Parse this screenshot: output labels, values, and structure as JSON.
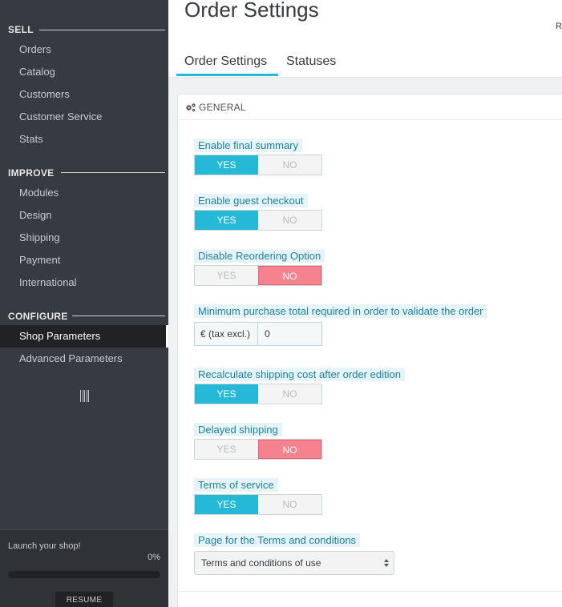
{
  "sidebar": {
    "sections": [
      {
        "title": "SELL",
        "items": [
          "Orders",
          "Catalog",
          "Customers",
          "Customer Service",
          "Stats"
        ]
      },
      {
        "title": "IMPROVE",
        "items": [
          "Modules",
          "Design",
          "Shipping",
          "Payment",
          "International"
        ]
      },
      {
        "title": "CONFIGURE",
        "items": [
          "Shop Parameters",
          "Advanced Parameters"
        ]
      }
    ],
    "active_item": "Shop Parameters",
    "launch": {
      "text": "Launch your shop!",
      "percent_label": "0%",
      "progress": 0,
      "resume_label": "RESUME"
    }
  },
  "header": {
    "title": "Order Settings",
    "right_text": "R",
    "tabs": [
      "Order Settings",
      "Statuses"
    ],
    "active_tab": "Order Settings"
  },
  "panel": {
    "title": "GENERAL",
    "fields": [
      {
        "label": "Enable final summary",
        "type": "switch",
        "value": "YES",
        "yes_label": "YES",
        "no_label": "NO"
      },
      {
        "label": "Enable guest checkout",
        "type": "switch",
        "value": "YES",
        "yes_label": "YES",
        "no_label": "NO"
      },
      {
        "label": "Disable Reordering Option",
        "type": "switch",
        "value": "NO",
        "yes_label": "YES",
        "no_label": "NO"
      },
      {
        "label": "Minimum purchase total required in order to validate the order",
        "type": "input",
        "addon": "€ (tax excl.)",
        "value": "0"
      },
      {
        "label": "Recalculate shipping cost after order edition",
        "type": "switch",
        "value": "YES",
        "yes_label": "YES",
        "no_label": "NO"
      },
      {
        "label": "Delayed shipping",
        "type": "switch",
        "value": "NO",
        "yes_label": "YES",
        "no_label": "NO"
      },
      {
        "label": "Terms of service",
        "type": "switch",
        "value": "YES",
        "yes_label": "YES",
        "no_label": "NO"
      },
      {
        "label": "Page for the Terms and conditions",
        "type": "select",
        "value": "Terms and conditions of use"
      }
    ]
  },
  "colors": {
    "accent": "#25b9d7",
    "no_active": "#f5828e",
    "sidebar_bg": "#363a41"
  }
}
